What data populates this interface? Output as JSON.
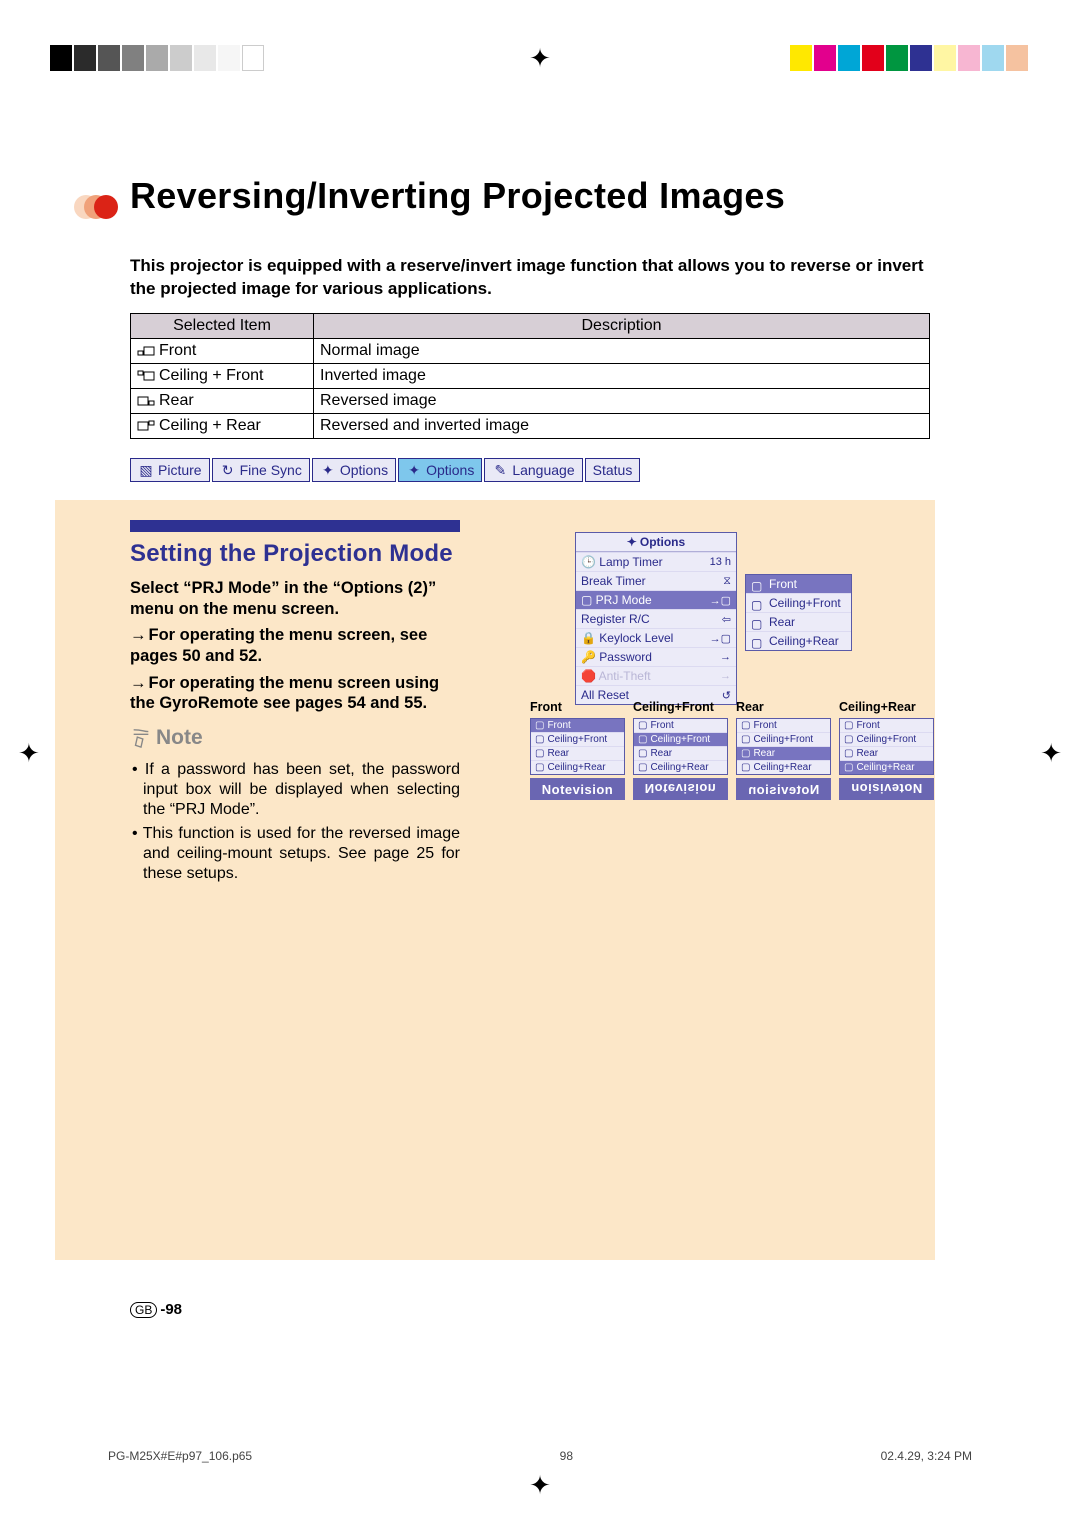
{
  "title": "Reversing/Inverting Projected Images",
  "intro": "This projector is equipped with a reserve/invert image function that allows you to reverse or invert the projected image for various applications.",
  "table": {
    "h1": "Selected Item",
    "h2": "Description",
    "rows": [
      {
        "item": "Front",
        "desc": "Normal image"
      },
      {
        "item": "Ceiling + Front",
        "desc": "Inverted image"
      },
      {
        "item": "Rear",
        "desc": "Reversed image"
      },
      {
        "item": "Ceiling + Rear",
        "desc": "Reversed and inverted image"
      }
    ]
  },
  "menubar": [
    "Picture",
    "Fine Sync",
    "Options",
    "Options",
    "Language",
    "Status"
  ],
  "menubar_selected_index": 3,
  "section_heading": "Setting the Projection Mode",
  "step_select": "Select “PRJ Mode” in the “Options (2)” menu on the menu screen.",
  "step_ref1": "For operating the menu screen, see pages 50 and 52.",
  "step_ref2": "For operating the menu screen using the GyroRemote see pages 54 and 55.",
  "note_heading": "Note",
  "note1": "If a password has been set, the password input box will be displayed when selecting the “PRJ Mode”.",
  "note2": "This function is used for the reversed image and ceiling-mount setups. See page 25 for these setups.",
  "osd": {
    "title": "Options",
    "rows": [
      {
        "label": "Lamp Timer",
        "val": "13 h"
      },
      {
        "label": "Break Timer",
        "val": "⧖"
      },
      {
        "label": "PRJ Mode",
        "val": "→▢",
        "sel": true
      },
      {
        "label": "Register R/C",
        "val": "⇦"
      },
      {
        "label": "Keylock Level",
        "val": "→▢"
      },
      {
        "label": "Password",
        "val": "→"
      },
      {
        "label": "Anti-Theft",
        "val": "→"
      },
      {
        "label": "All Reset",
        "val": "↺"
      }
    ],
    "submenu": [
      "Front",
      "Ceiling+Front",
      "Rear",
      "Ceiling+Rear"
    ],
    "submenu_selected": 0
  },
  "thumbs": {
    "labels": [
      "Front",
      "Ceiling+Front",
      "Rear",
      "Ceiling+Rear"
    ],
    "brand": "Notevision"
  },
  "page_label_prefix": "GB",
  "page_number": "-98",
  "footer_file": "PG-M25X#E#p97_106.p65",
  "footer_page": "98",
  "footer_date": "02.4.29, 3:24 PM"
}
